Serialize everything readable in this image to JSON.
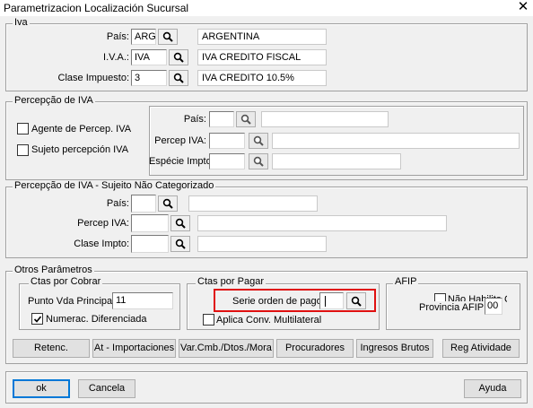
{
  "window": {
    "title": "Parametrizacion Localización Sucursal",
    "close": "✕"
  },
  "iva": {
    "legend": "Iva",
    "pais_label": "País:",
    "pais_code": "ARG",
    "pais_desc": "ARGENTINA",
    "iva_label": "I.V.A.:",
    "iva_code": "IVA",
    "iva_desc": "IVA   CREDITO FISCAL",
    "clase_label": "Clase  Impuesto:",
    "clase_code": "3",
    "clase_desc": "IVA CREDITO 10.5%"
  },
  "percep": {
    "legend": "Percepção de IVA",
    "agente_label": "Agente de Percep. IVA",
    "sujeto_label": "Sujeto percepción IVA",
    "pais_label": "País:",
    "percep_label": "Percep IVA:",
    "especie_label": "Espécie Impto:"
  },
  "nocat": {
    "legend": "Percepção de IVA - Sujeito Não Categorizado",
    "pais_label": "País:",
    "percep_label": "Percep IVA:",
    "clase_label": "Clase Impto:"
  },
  "otros": {
    "legend": "Otros Parâmetros",
    "cobrar": {
      "legend": "Ctas por Cobrar",
      "punto_label": "Punto Vda Principal:",
      "punto_value": "11",
      "numerac_label": "Numerac. Diferenciada",
      "numerac_checked": true
    },
    "pagar": {
      "legend": "Ctas por Pagar",
      "serie_label": "Serie orden de pago:",
      "serie_value": "",
      "aplica_label": "Aplica Conv. Multilateral"
    },
    "afip": {
      "legend": "AFIP",
      "hidden_label": "Não Habilita CAI",
      "provincia_label": "Provincia AFIP:",
      "provincia_value": "00"
    }
  },
  "buttons": {
    "retenc": "Retenc.",
    "importaciones": "At - Importaciones",
    "varcmb": "Var.Cmb./Dtos./Mora",
    "procuradores": "Procuradores",
    "ingresos": "Ingresos Brutos",
    "regatividade": "Reg Atividade"
  },
  "footer": {
    "ok": "ok",
    "cancela": "Cancela",
    "ayuda": "Ayuda"
  },
  "icons": {
    "lookup": "magnifier-icon",
    "close": "close-icon"
  },
  "colors": {
    "highlight": "#e01010",
    "background": "#f0f0f0",
    "default_button_border": "#0078d7"
  }
}
